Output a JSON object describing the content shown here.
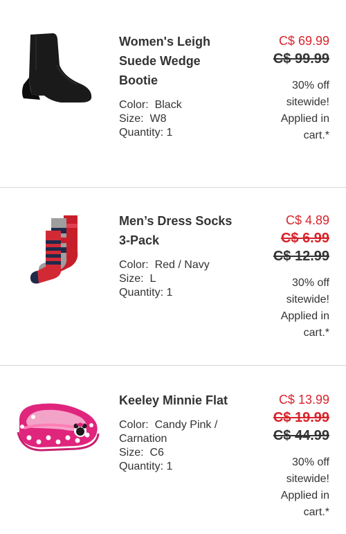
{
  "items": [
    {
      "name_lines": [
        "Women's Leigh",
        "Suede Wedge",
        "Bootie"
      ],
      "color_label": "Color:",
      "color_value": "Black",
      "size_label": "Size:",
      "size_value": "W8",
      "qty_label": "Quantity:",
      "qty_value": "1",
      "price_current": "C$ 69.99",
      "price_was": [
        "C$ 99.99"
      ],
      "promo_lines": [
        "30% off",
        "sitewide!",
        "Applied in",
        "cart.*"
      ],
      "image_icon": "black-wedge-bootie-icon"
    },
    {
      "name_lines": [
        "Men’s Dress Socks",
        "3-Pack"
      ],
      "color_label": "Color:",
      "color_value": "Red / Navy",
      "size_label": "Size:",
      "size_value": "L",
      "qty_label": "Quantity:",
      "qty_value": "1",
      "price_current": "C$ 4.89",
      "price_was": [
        "C$ 6.99",
        "C$ 12.99"
      ],
      "promo_lines": [
        "30% off",
        "sitewide!",
        "Applied in",
        "cart.*"
      ],
      "image_icon": "striped-socks-icon"
    },
    {
      "name_lines": [
        "Keeley Minnie Flat"
      ],
      "color_label": "Color:",
      "color_value_lines": [
        "Candy Pink /",
        "Carnation"
      ],
      "size_label": "Size:",
      "size_value": "C6",
      "qty_label": "Quantity:",
      "qty_value": "1",
      "price_current": "C$ 13.99",
      "price_was": [
        "C$ 19.99",
        "C$ 44.99"
      ],
      "promo_lines": [
        "30% off",
        "sitewide!",
        "Applied in",
        "cart.*"
      ],
      "image_icon": "pink-minnie-flat-icon"
    }
  ],
  "colors": {
    "sale_red": "#d8232a",
    "text": "#333333",
    "divider": "#d4d4d4"
  }
}
